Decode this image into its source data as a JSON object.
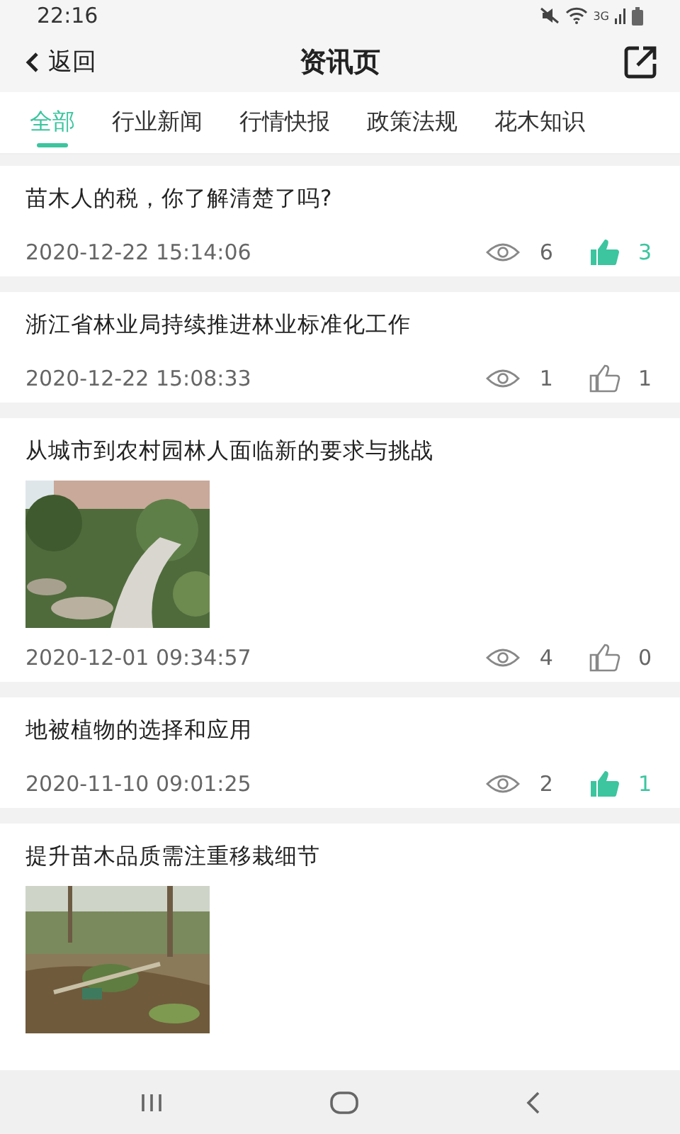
{
  "status_bar": {
    "time": "22:16",
    "network": "3G"
  },
  "header": {
    "back": "返回",
    "title": "资讯页"
  },
  "tabs": [
    {
      "label": "全部",
      "selected": true
    },
    {
      "label": "行业新闻",
      "selected": false
    },
    {
      "label": "行情快报",
      "selected": false
    },
    {
      "label": "政策法规",
      "selected": false
    },
    {
      "label": "花木知识",
      "selected": false
    }
  ],
  "articles": [
    {
      "kind": "text",
      "title": "苗木人的税，你了解清楚了吗?",
      "date": "2020-12-22 15:14:06",
      "views": "6",
      "likes": "3",
      "liked": true
    },
    {
      "kind": "text",
      "title": "浙江省林业局持续推进林业标准化工作",
      "date": "2020-12-22 15:08:33",
      "views": "1",
      "likes": "1",
      "liked": false
    },
    {
      "kind": "picture",
      "title": "从城市到农村园林人面临新的要求与挑战",
      "date": "2020-12-01 09:34:57",
      "views": "4",
      "likes": "0",
      "liked": false
    },
    {
      "kind": "text",
      "title": "地被植物的选择和应用",
      "date": "2020-11-10 09:01:25",
      "views": "2",
      "likes": "1",
      "liked": true
    },
    {
      "kind": "picture",
      "title": "提升苗木品质需注重移栽细节"
    }
  ]
}
